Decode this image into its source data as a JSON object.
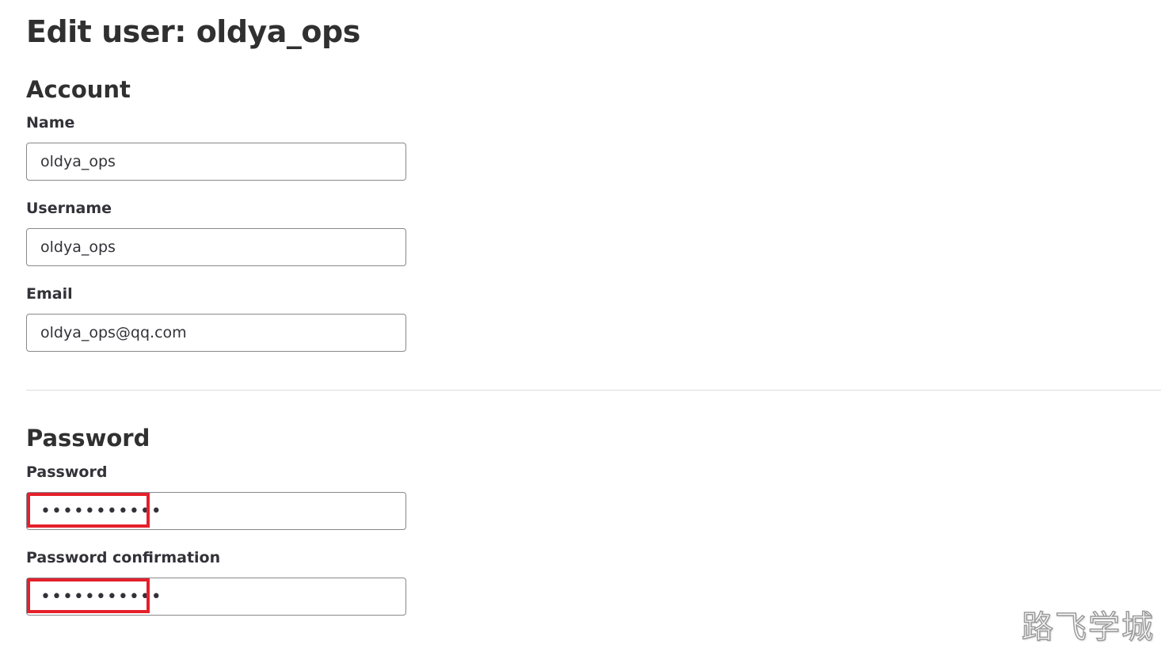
{
  "page": {
    "title": "Edit user: oldya_ops"
  },
  "account": {
    "heading": "Account",
    "name_label": "Name",
    "name_value": "oldya_ops",
    "username_label": "Username",
    "username_value": "oldya_ops",
    "email_label": "Email",
    "email_value": "oldya_ops@qq.com"
  },
  "password": {
    "heading": "Password",
    "password_label": "Password",
    "password_masked": "•••••••••••",
    "confirmation_label": "Password confirmation",
    "confirmation_masked": "•••••••••••"
  },
  "annotations": {
    "highlight_color": "#e4202b"
  },
  "watermark": {
    "text": "路飞学城"
  }
}
